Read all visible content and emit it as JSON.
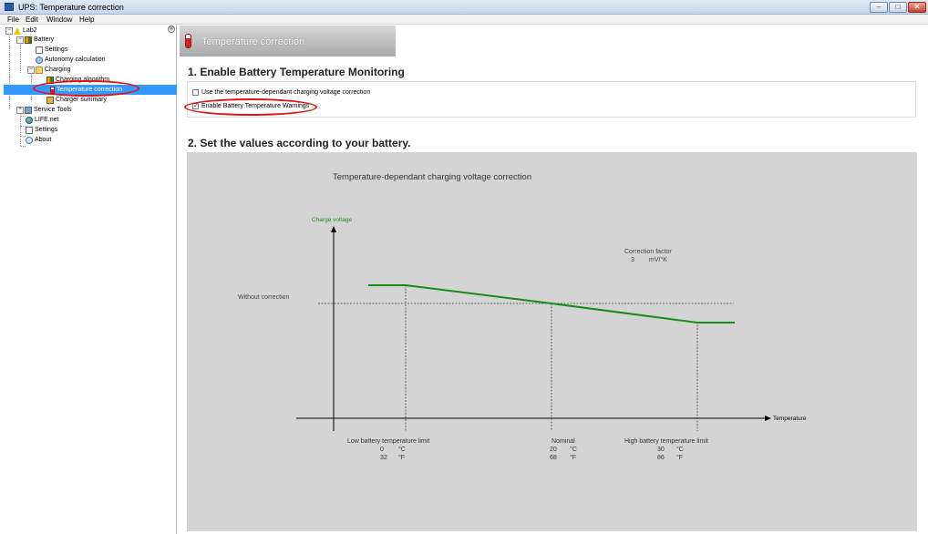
{
  "window": {
    "title": "UPS: Temperature correction",
    "controls": {
      "minimize": "–",
      "maximize": "□",
      "close": "✕"
    }
  },
  "menu": [
    "File",
    "Edit",
    "Window",
    "Help"
  ],
  "tree": {
    "close_glyph": "⊗",
    "items": [
      {
        "label": "Lab2",
        "expander": "−",
        "icon": "warning-icon"
      },
      {
        "label": "Battery",
        "expander": "−",
        "icon": "battery-icon"
      },
      {
        "label": "Settings",
        "icon": "settings-page-icon"
      },
      {
        "label": "Autonomy calculation",
        "icon": "gauge-icon"
      },
      {
        "label": "Charging",
        "expander": "−",
        "icon": "folder-icon"
      },
      {
        "label": "Charging algorithm",
        "icon": "battery-icon"
      },
      {
        "label": "Temperature correction",
        "icon": "thermometer-icon",
        "selected": true
      },
      {
        "label": "Charger summary",
        "icon": "charger-icon"
      },
      {
        "label": "Service Tools",
        "expander": "+",
        "icon": "tools-icon"
      },
      {
        "label": "LIFE.net",
        "icon": "globe-icon"
      },
      {
        "label": "Settings",
        "icon": "settings-page-icon"
      },
      {
        "label": "About",
        "icon": "about-icon"
      }
    ]
  },
  "header": {
    "title": "Temperature correction",
    "icon": "thermometer-icon"
  },
  "section1": {
    "title": "1. Enable Battery Temperature Monitoring",
    "options": [
      {
        "label": "Use the temperature-dependant charging voltage correction",
        "checked": false
      },
      {
        "label": "Enable Battery Temperature Warnings",
        "checked": true
      }
    ],
    "check_glyph": "✓"
  },
  "section2": {
    "title": "2. Set the values according to your battery."
  },
  "chart": {
    "title": "Temperature-dependant charging voltage correction",
    "y_axis_label": "Charge voltage",
    "x_axis_label": "Temperature",
    "reference_label": "Without correction",
    "correction_factor": {
      "label": "Correction factor",
      "value": "3",
      "unit": "mV/°K"
    },
    "markers": [
      {
        "label": "Low battery temperature limit",
        "celsius": "0",
        "fahrenheit": "32"
      },
      {
        "label": "Nominal",
        "celsius": "20",
        "fahrenheit": "68"
      },
      {
        "label": "High battery temperature limit",
        "celsius": "30",
        "fahrenheit": "86"
      }
    ],
    "units": {
      "celsius": "°C",
      "fahrenheit": "°F"
    },
    "colors": {
      "line": "#1a8a1a",
      "axis_label": "#1a8a1a",
      "background": "#d4d4d4"
    }
  }
}
